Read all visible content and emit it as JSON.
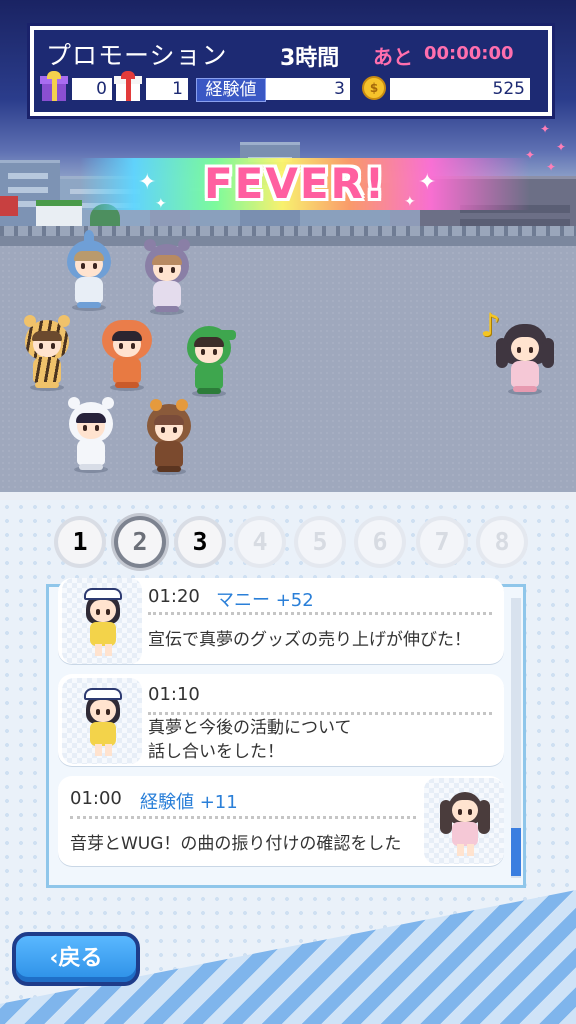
{
  "hud": {
    "title": "プロモーション",
    "duration": "3時間",
    "remaining_label": "あと",
    "remaining_time": "00:00:00",
    "gift_purple_count": "0",
    "gift_red_count": "1",
    "exp_label": "経験値",
    "exp_value": "3",
    "coin_count": "525",
    "coin_icon": "coin-icon"
  },
  "banner": {
    "text": "FEVER!"
  },
  "page_tabs": [
    {
      "label": "1",
      "state": "enabled"
    },
    {
      "label": "2",
      "state": "selected"
    },
    {
      "label": "3",
      "state": "enabled"
    },
    {
      "label": "4",
      "state": "disabled"
    },
    {
      "label": "5",
      "state": "disabled"
    },
    {
      "label": "6",
      "state": "disabled"
    },
    {
      "label": "7",
      "state": "disabled"
    },
    {
      "label": "8",
      "state": "disabled"
    }
  ],
  "log": [
    {
      "time": "01:20",
      "gain": "マニー +52",
      "text": "宣伝で真夢のグッズの売り上げが伸びた！"
    },
    {
      "time": "01:10",
      "gain": "",
      "text_line1": "真夢と今後の活動について",
      "text_line2": "話し合いをした！"
    },
    {
      "time": "01:00",
      "gain": "経験値 +11",
      "text": "音芽とWUG！の曲の振り付けの確認をした"
    }
  ],
  "back_button": {
    "label": "戻る",
    "icon": "chevron-left-icon"
  },
  "colors": {
    "accent": "#2b8fe6",
    "pink": "#ff6fae",
    "hud_bg": "#1d2a73"
  }
}
